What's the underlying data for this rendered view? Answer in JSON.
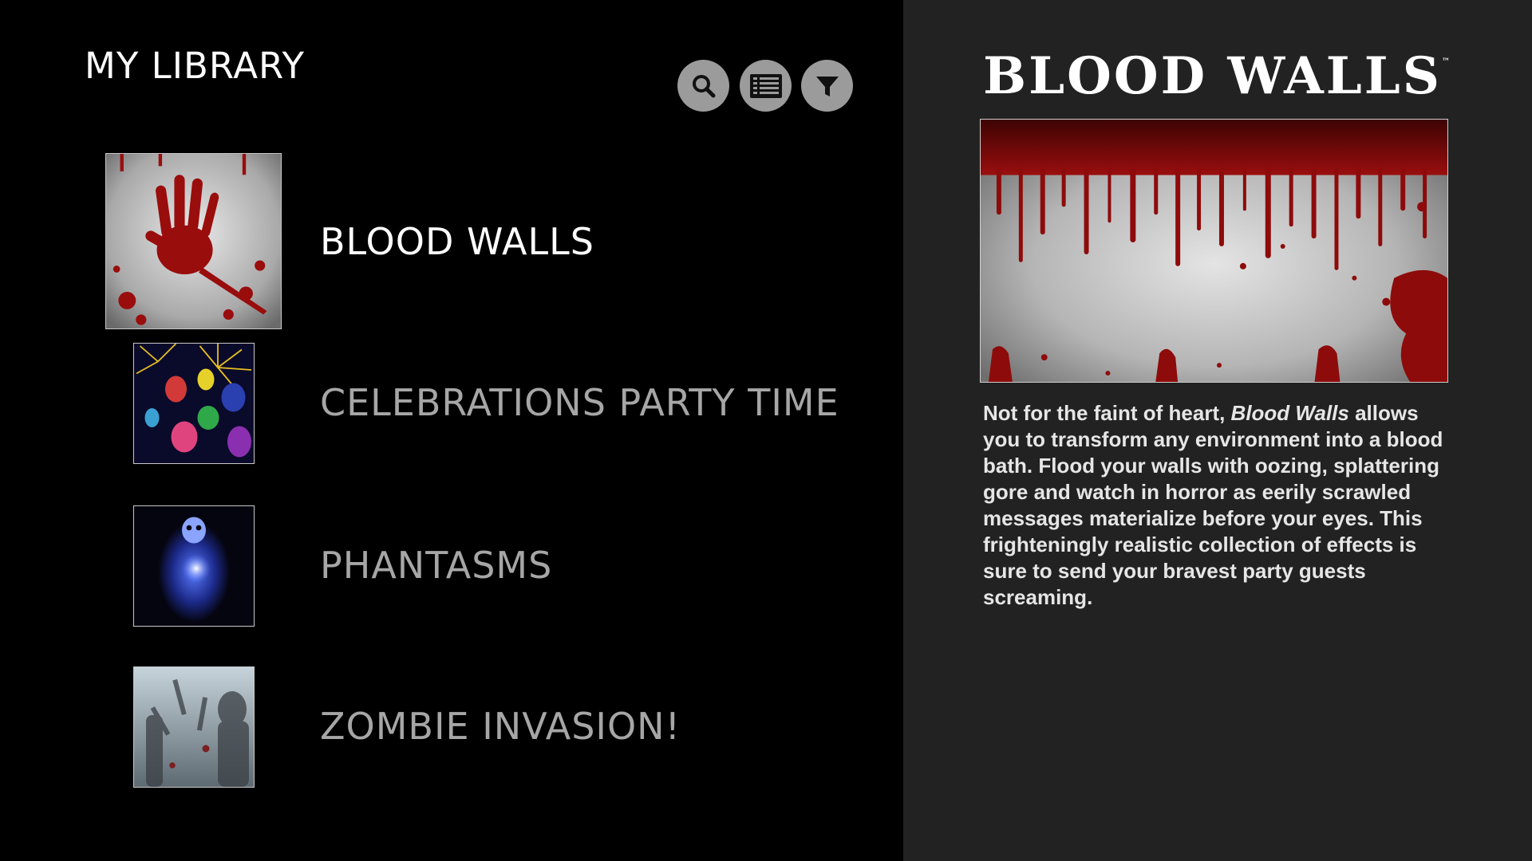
{
  "library": {
    "title": "MY LIBRARY",
    "toolbar": [
      {
        "name": "search-button",
        "icon": "search-icon"
      },
      {
        "name": "list-view-button",
        "icon": "list-icon"
      },
      {
        "name": "filter-button",
        "icon": "filter-icon"
      }
    ],
    "items": [
      {
        "label": "BLOOD WALLS",
        "selected": true
      },
      {
        "label": "CELEBRATIONS PARTY TIME",
        "selected": false
      },
      {
        "label": "PHANTASMS",
        "selected": false
      },
      {
        "label": "ZOMBIE INVASION!",
        "selected": false
      }
    ]
  },
  "detail": {
    "title": "BLOOD WALLS",
    "trademark": "™",
    "desc_before": "Not for the faint of heart, ",
    "desc_italic": "Blood Walls",
    "desc_after": " allows you to transform any environment into a blood bath. Flood your walls with oozing, splattering gore and watch in horror as eerily scrawled messages materialize before your eyes. This frighteningly realistic collection of effects is sure to send your bravest party guests screaming."
  },
  "colors": {
    "left_bg": "#000000",
    "right_bg": "#222222",
    "button_bg": "#9b9b9b",
    "active_text": "#ffffff",
    "inactive_text": "#a6a6a6",
    "blood": "#8b0a0a"
  }
}
